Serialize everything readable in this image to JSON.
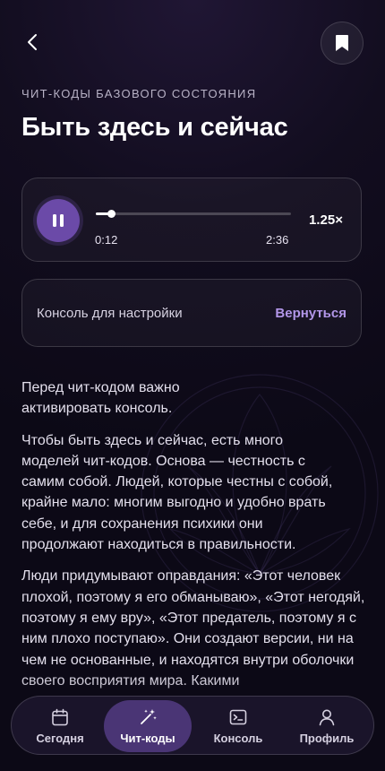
{
  "header": {
    "category": "ЧИТ-КОДЫ БАЗОВОГО СОСТОЯНИЯ",
    "title": "Быть здесь и сейчас"
  },
  "player": {
    "current_time": "0:12",
    "total_time": "2:36",
    "speed": "1.25×",
    "progress": 0.077,
    "state": "playing"
  },
  "console_card": {
    "label": "Консоль для настройки",
    "action": "Вернуться"
  },
  "paragraphs": [
    "Перед чит-кодом важно активировать консоль.",
    "Чтобы быть здесь и сейчас, есть много моделей чит-кодов. Основа — честность с самим собой. Людей, которые честны с собой, крайне мало: многим выгодно и удобно врать себе, и для сохранения психики они продолжают находиться в правильности.",
    "Люди придумывают оправдания: «Этот человек плохой, поэтому я его обманываю», «Этот негодяй, поэтому я ему вру», «Этот предатель, поэтому я с ним плохо поступаю». Они создают версии, ни на чем не основанные, и находятся внутри оболочки своего восприятия мира. Какими"
  ],
  "tabs": [
    {
      "label": "Сегодня",
      "icon": "calendar-icon",
      "active": false
    },
    {
      "label": "Чит-коды",
      "icon": "magic-wand-icon",
      "active": true
    },
    {
      "label": "Консоль",
      "icon": "terminal-icon",
      "active": false
    },
    {
      "label": "Профиль",
      "icon": "user-icon",
      "active": false
    }
  ],
  "colors": {
    "accent": "#b296e8",
    "pause_button": "#6b4aa8",
    "active_tab": "#4a3575",
    "background": "#120d1f"
  }
}
